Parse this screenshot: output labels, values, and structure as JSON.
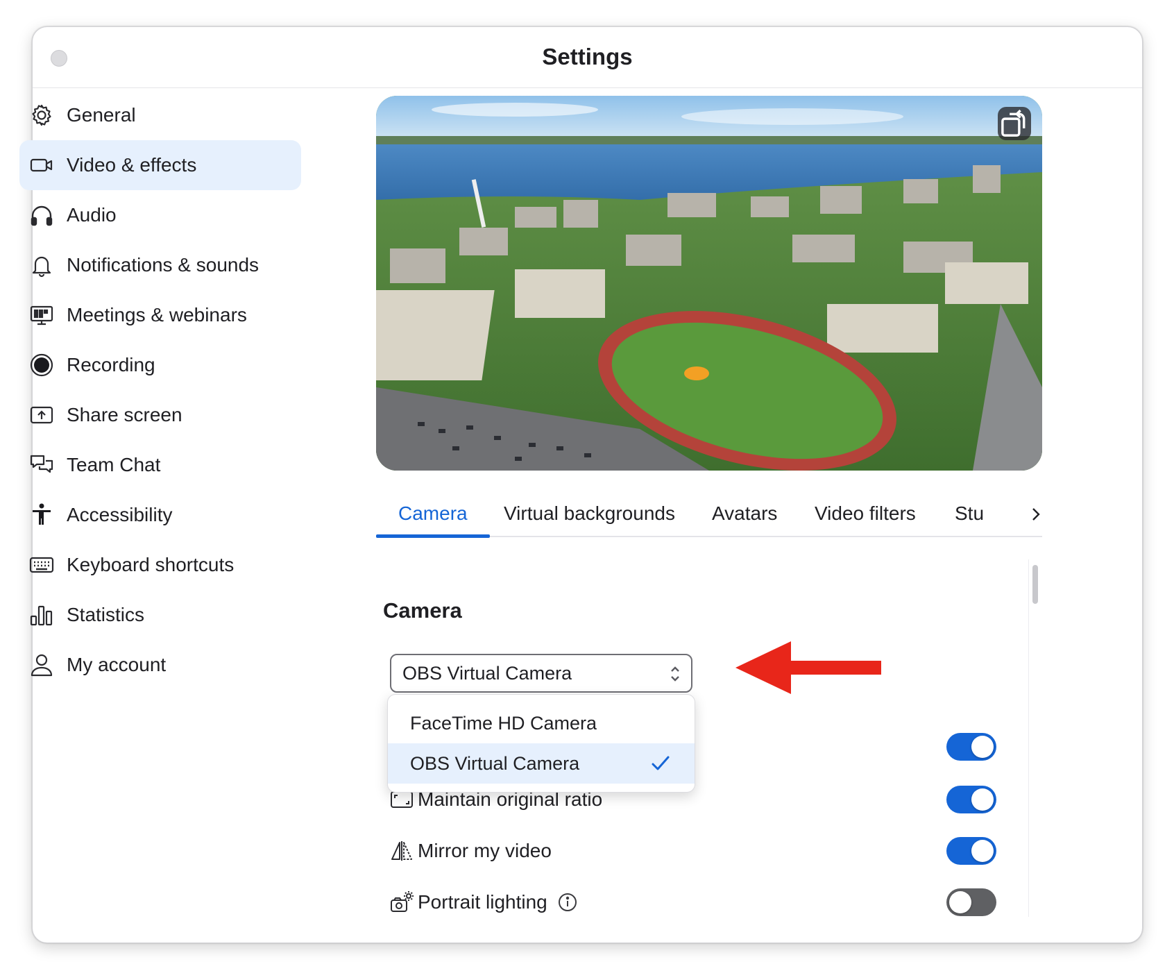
{
  "window": {
    "title": "Settings"
  },
  "sidebar": {
    "items": [
      {
        "id": "general",
        "label": "General",
        "icon": "gear-icon",
        "active": false
      },
      {
        "id": "video",
        "label": "Video & effects",
        "icon": "video-camera-icon",
        "active": true
      },
      {
        "id": "audio",
        "label": "Audio",
        "icon": "headphones-icon",
        "active": false
      },
      {
        "id": "notifications",
        "label": "Notifications & sounds",
        "icon": "bell-icon",
        "active": false
      },
      {
        "id": "meetings",
        "label": "Meetings & webinars",
        "icon": "presentation-screen-icon",
        "active": false
      },
      {
        "id": "recording",
        "label": "Recording",
        "icon": "record-icon",
        "active": false
      },
      {
        "id": "share",
        "label": "Share screen",
        "icon": "share-screen-icon",
        "active": false
      },
      {
        "id": "chat",
        "label": "Team Chat",
        "icon": "chat-bubbles-icon",
        "active": false
      },
      {
        "id": "accessibility",
        "label": "Accessibility",
        "icon": "accessibility-icon",
        "active": false
      },
      {
        "id": "keyboard",
        "label": "Keyboard shortcuts",
        "icon": "keyboard-icon",
        "active": false
      },
      {
        "id": "statistics",
        "label": "Statistics",
        "icon": "bar-chart-icon",
        "active": false
      },
      {
        "id": "account",
        "label": "My account",
        "icon": "user-icon",
        "active": false
      }
    ]
  },
  "tabs": {
    "items": [
      {
        "label": "Camera",
        "active": true
      },
      {
        "label": "Virtual backgrounds",
        "active": false
      },
      {
        "label": "Avatars",
        "active": false
      },
      {
        "label": "Video filters",
        "active": false
      },
      {
        "label": "Stu",
        "active": false
      }
    ]
  },
  "camera": {
    "section_title": "Camera",
    "selected": "OBS Virtual Camera",
    "options": [
      {
        "label": "FaceTime HD Camera",
        "selected": false
      },
      {
        "label": "OBS Virtual Camera",
        "selected": true
      }
    ]
  },
  "settings": [
    {
      "label": "",
      "icon": "",
      "on": true
    },
    {
      "label": "Maintain original ratio",
      "icon": "aspect-ratio-icon",
      "on": true
    },
    {
      "label": "Mirror my video",
      "icon": "mirror-icon",
      "on": true
    },
    {
      "label": "Portrait lighting",
      "icon": "portrait-lighting-icon",
      "on": false,
      "info": true
    }
  ],
  "colors": {
    "accent": "#1565d6",
    "active_bg": "#e6f0fd",
    "toggle_off": "#5f6063",
    "annotation_arrow": "#e8261a"
  }
}
